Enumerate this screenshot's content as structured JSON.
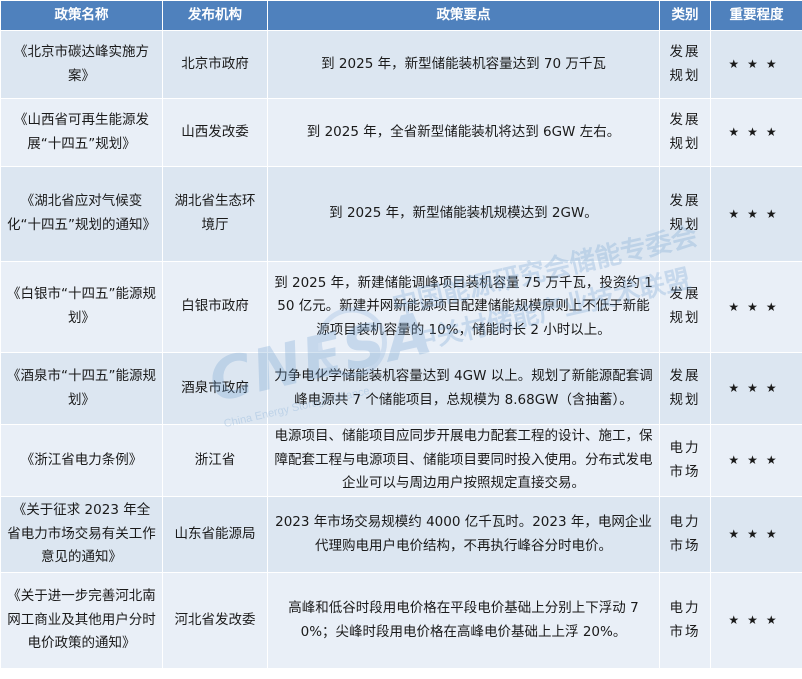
{
  "headers": [
    "政策名称",
    "发布机构",
    "政策要点",
    "类别",
    "重要程度"
  ],
  "rows": [
    {
      "name": "《北京市碳达峰实施方案》",
      "org": "北京市政府",
      "point": "到 2025 年，新型储能装机容量达到 70 万千瓦",
      "type": "发展规划",
      "level": "★★★"
    },
    {
      "name": "《山西省可再生能源发展“十四五”规划》",
      "org": "山西发改委",
      "point": "到 2025 年，全省新型储能装机将达到 6GW 左右。",
      "type": "发展规划",
      "level": "★★★"
    },
    {
      "name": "《湖北省应对气候变化“十四五”规划的通知》",
      "org": "湖北省生态环境厅",
      "point": "到 2025 年，新型储能装机规模达到 2GW。",
      "type": "发展规划",
      "level": "★★★"
    },
    {
      "name": "《白银市“十四五”能源规划》",
      "org": "白银市政府",
      "point": "到 2025 年，新建储能调峰项目装机容量 75 万千瓦，投资约 150 亿元。新建并网新能源项目配建储能规模原则上不低于新能源项目装机容量的 10%，储能时长 2 小时以上。",
      "type": "发展规划",
      "level": "★★★"
    },
    {
      "name": "《酒泉市“十四五”能源规划》",
      "org": "酒泉市政府",
      "point": "力争电化学储能装机容量达到 4GW 以上。规划了新能源配套调峰电源共 7 个储能项目，总规模为 8.68GW（含抽蓄）。",
      "type": "发展规划",
      "level": "★★★"
    },
    {
      "name": "《浙江省电力条例》",
      "org": "浙江省",
      "point": "电源项目、储能项目应同步开展电力配套工程的设计、施工，保障配套工程与电源项目、储能项目要同时投入使用。分布式发电企业可以与周边用户按照规定直接交易。",
      "type": "电力市场",
      "level": "★★★"
    },
    {
      "name": "《关于征求 2023 年全省电力市场交易有关工作意见的通知》",
      "org": "山东省能源局",
      "point": "2023 年市场交易规模约 4000 亿千瓦时。2023 年，电网企业代理购电用户电价结构，不再执行峰谷分时电价。",
      "type": "电力市场",
      "level": "★★★"
    },
    {
      "name": "《关于进一步完善河北南网工商业及其他用户分时电价政策的通知》",
      "org": "河北省发改委",
      "point": "高峰和低谷时段用电价格在平段电价基础上分别上下浮动 70%；尖峰时段用电价格在高峰电价基础上上浮 20%。",
      "type": "电力市场",
      "level": "★★★"
    }
  ],
  "watermark": {
    "logo": "CNESA",
    "sub": "China Energy Storage Alliance",
    "cn_line1": "中国能源研究会储能专委会",
    "cn_line2": "中关村储能产业技术联盟"
  }
}
